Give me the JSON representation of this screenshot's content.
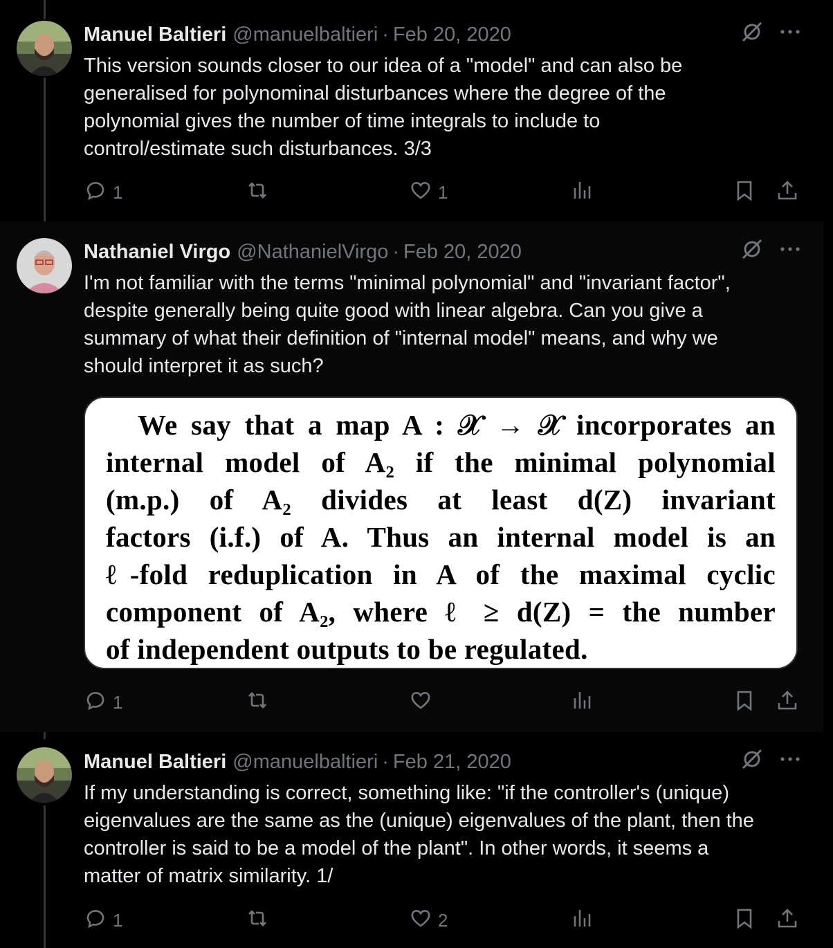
{
  "tweets": [
    {
      "author": "Manuel Baltieri",
      "handle": "@manuelbaltieri",
      "separator": "·",
      "date": "Feb 20, 2020",
      "text": "This version sounds closer to our idea of a \"model\" and can also be\ngeneralised for polynominal disturbances where the degree of the\npolynomial gives the number of time integrals to include to\ncontrol/estimate such disturbances. 3/3",
      "replies": "1",
      "reposts": "",
      "likes": "1"
    },
    {
      "author": "Nathaniel Virgo",
      "handle": "@NathanielVirgo",
      "separator": "·",
      "date": "Feb 20, 2020",
      "text": "I'm not familiar with the terms \"minimal polynomial\" and \"invariant factor\",\ndespite generally being quite good with linear algebra. Can you give a\nsummary of what their definition of \"internal model\" means, and why we\nshould interpret it as such?",
      "image_text": [
        "We say that a map A : 𝒳 → 𝒳 incorporates an",
        "internal model of A₂ if the minimal polynomial",
        "(m.p.) of A₂ divides at least d(Z) invariant",
        "factors (i.f.) of A. Thus an internal model is an",
        "ℓ-fold reduplication in A of the maximal cyclic",
        "component of A₂, where ℓ ≥ d(Z) = the number",
        "of independent outputs to be regulated."
      ],
      "replies": "1",
      "reposts": "",
      "likes": ""
    },
    {
      "author": "Manuel Baltieri",
      "handle": "@manuelbaltieri",
      "separator": "·",
      "date": "Feb 21, 2020",
      "text": "If my understanding is correct, something like: \"if the controller's (unique)\neigenvalues are the same as the (unique) eigenvalues of the plant, then the\ncontroller is said to be a model of the plant\". In other words, it seems a\nmatter of matrix similarity. 1/",
      "replies": "1",
      "reposts": "",
      "likes": "2"
    }
  ],
  "colors": {
    "background": "#000000",
    "text": "#e7e9ea",
    "secondary": "#71767b",
    "thread_line": "#333639"
  },
  "icons": [
    "reply-icon",
    "repost-icon",
    "like-icon",
    "views-icon",
    "bookmark-icon",
    "share-icon",
    "grok-icon",
    "more-icon"
  ]
}
